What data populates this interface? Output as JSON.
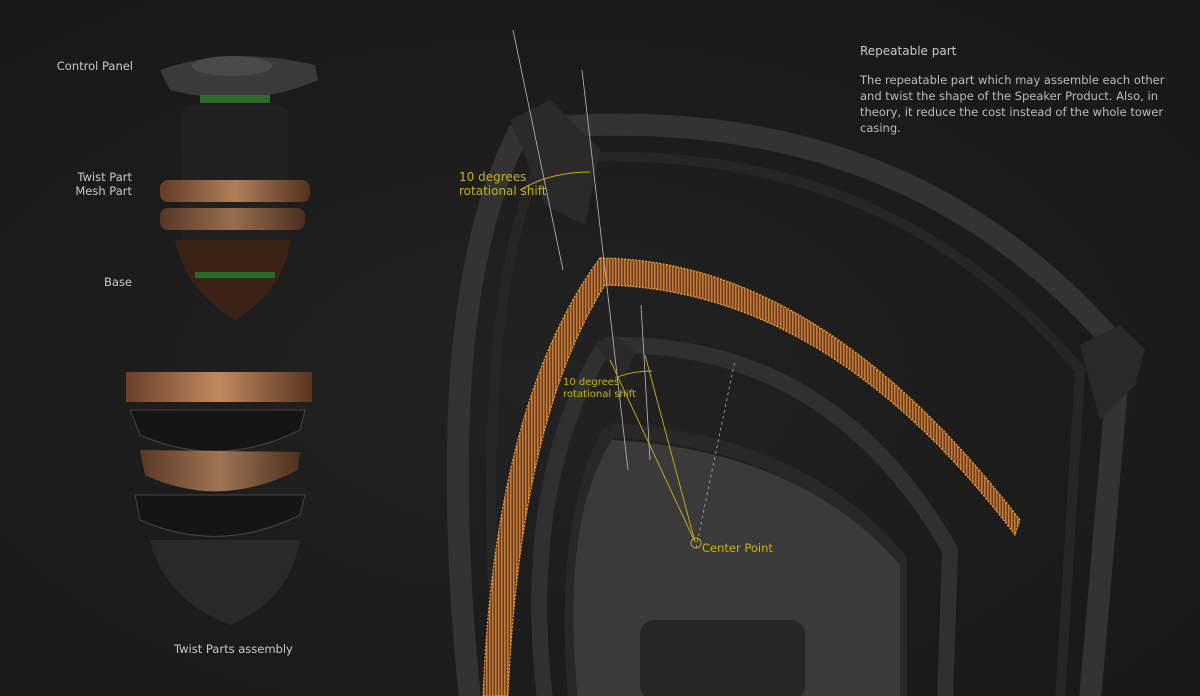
{
  "left_labels": {
    "control_panel": "Control Panel",
    "twist_part": "Twist Part",
    "mesh_part": "Mesh Part",
    "base": "Base",
    "assembly_caption": "Twist Parts assembly"
  },
  "annotations": {
    "outer_shift_line1": "10 degrees",
    "outer_shift_line2": "rotational shift",
    "inner_shift_line1": "10 degrees",
    "inner_shift_line2": "rotational shift",
    "center_point": "Center Point"
  },
  "description": {
    "title": "Repeatable part",
    "body": "The repeatable part which may assemble each other and twist the shape of the Speaker Product. Also, in theory, it reduce the cost instead of the whole tower casing."
  },
  "colors": {
    "background": "#1b1b1b",
    "annotation": "#c6b31a",
    "mesh": "#b8703a",
    "casing": "#2c2c2c"
  }
}
